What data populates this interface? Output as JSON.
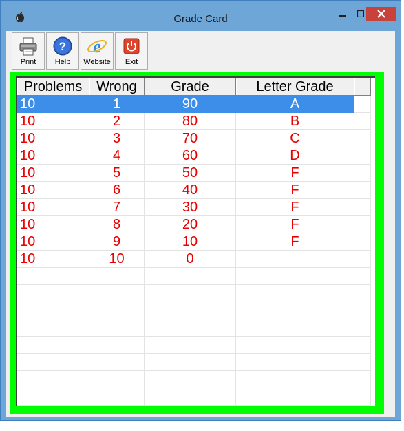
{
  "window": {
    "title": "Grade Card"
  },
  "toolbar": {
    "print": "Print",
    "help": "Help",
    "website": "Website",
    "exit": "Exit"
  },
  "table": {
    "headers": [
      "Problems",
      "Wrong",
      "Grade",
      "Letter Grade"
    ],
    "selected_row": 0,
    "rows": [
      [
        "10",
        "1",
        "90",
        "A"
      ],
      [
        "10",
        "2",
        "80",
        "B"
      ],
      [
        "10",
        "3",
        "70",
        "C"
      ],
      [
        "10",
        "4",
        "60",
        "D"
      ],
      [
        "10",
        "5",
        "50",
        "F"
      ],
      [
        "10",
        "6",
        "40",
        "F"
      ],
      [
        "10",
        "7",
        "30",
        "F"
      ],
      [
        "10",
        "8",
        "20",
        "F"
      ],
      [
        "10",
        "9",
        "10",
        "F"
      ],
      [
        "10",
        "10",
        "0",
        ""
      ]
    ],
    "empty_rows": 8
  },
  "colors": {
    "frame_green": "#00ff00",
    "row_text_red": "#e80000",
    "selection_blue": "#3d8ee8",
    "close_red": "#c7423b"
  },
  "icons": [
    "app-apple-icon",
    "printer-icon",
    "help-icon",
    "internet-explorer-icon",
    "power-icon"
  ]
}
